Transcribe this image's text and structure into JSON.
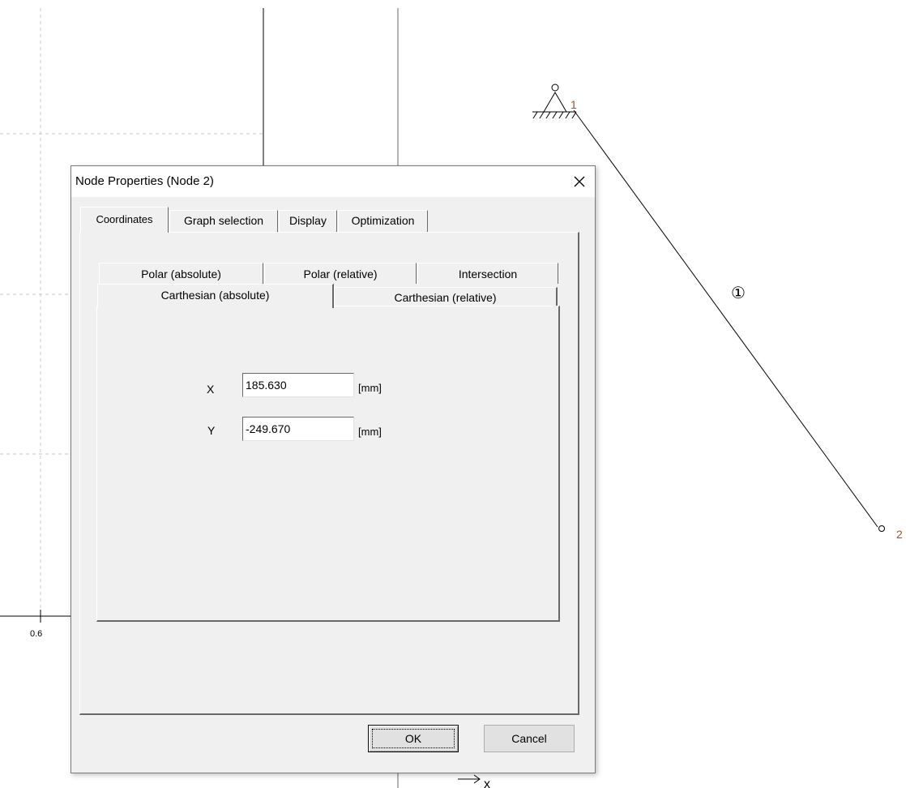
{
  "canvas": {
    "axis_tick_label": "0.6",
    "axis_label_x": "x",
    "element_label": "①",
    "node1_label": "1",
    "node2_label": "2",
    "node_label_color": "#a0522d"
  },
  "dialog": {
    "title": "Node Properties (Node 2)",
    "outer_tabs": [
      {
        "label": "Coordinates",
        "selected": true
      },
      {
        "label": "Graph selection",
        "selected": false
      },
      {
        "label": "Display",
        "selected": false
      },
      {
        "label": "Optimization",
        "selected": false
      }
    ],
    "inner_tabs_back_row": [
      {
        "label": "Polar (absolute)"
      },
      {
        "label": "Polar (relative)"
      },
      {
        "label": "Intersection"
      }
    ],
    "inner_tabs_front_row": [
      {
        "label": "Carthesian (absolute)",
        "selected": true
      },
      {
        "label": "Carthesian (relative)",
        "selected": false
      }
    ],
    "fields": {
      "x": {
        "label": "X",
        "value": "185.630",
        "unit": "[mm]"
      },
      "y": {
        "label": "Y",
        "value": "-249.670",
        "unit": "[mm]"
      }
    },
    "buttons": {
      "ok": "OK",
      "cancel": "Cancel"
    }
  }
}
